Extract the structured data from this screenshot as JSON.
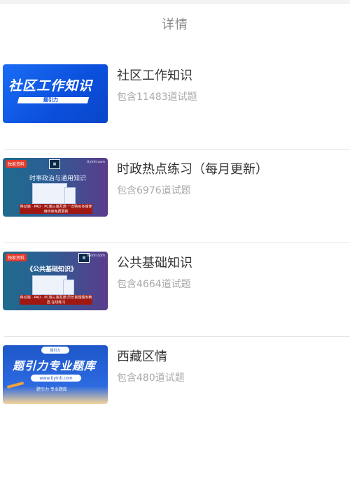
{
  "header": {
    "title": "详情"
  },
  "items": [
    {
      "title": "社区工作知识",
      "count": "包含11483道试题",
      "thumb": {
        "headline": "社区工作知识",
        "bar_text": "题引力"
      }
    },
    {
      "title": "时政热点练习（每月更新）",
      "count": "包含6976道试题",
      "thumb": {
        "tag": "独家资料",
        "brand": "tiyinli.com",
        "subtitle": "时事政治与通用知识",
        "bar_text": "移动端 · PAD · PC端三端互通 一次购买多端使用终身免费更新"
      }
    },
    {
      "title": "公共基础知识",
      "count": "包含4664道试题",
      "thumb": {
        "tag": "独家资料",
        "brand": "tiyinli.com",
        "subtitle": "《公共基础知识》",
        "bar_text": "移动端 · PAD · PC端三端互通 历年真题题库精选 在线练习"
      }
    },
    {
      "title": "西藏区情",
      "count": "包含480道试题",
      "thumb": {
        "pill": "题引力",
        "headline": "题引力专业题库",
        "url": "www.tiyinli.com",
        "slogan": "题引力 专业题库"
      }
    }
  ]
}
